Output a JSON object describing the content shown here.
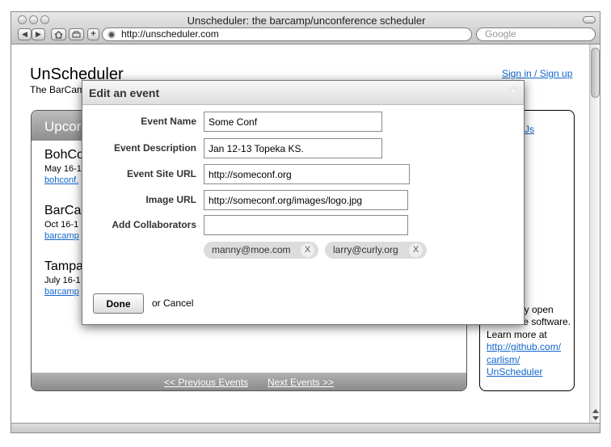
{
  "browser": {
    "window_title": "Unscheduler: the barcamp/unconference scheduler",
    "url": "http://unscheduler.com",
    "search_placeholder": "Google",
    "nav_back": "◀",
    "nav_forward": "▶",
    "add_bookmark": "+"
  },
  "site": {
    "title": "UnScheduler",
    "tagline": "The BarCam",
    "signin_label": "Sign in / Sign up"
  },
  "events_panel": {
    "title": "Upcor",
    "events": [
      {
        "name": "BohCo",
        "date": "May 16-1",
        "link": "bohconf."
      },
      {
        "name": "BarCa",
        "date": "Oct 16-1",
        "link": "barcamp"
      },
      {
        "name": "Tampa",
        "date": "July 16-1",
        "link": "barcamp"
      }
    ],
    "prev_label": "<< Previous Events",
    "next_label": "Next Events >>"
  },
  "aside": {
    "top_link": "Js",
    "text_lines": [
      "is",
      "by open",
      "source software.",
      "Learn more at"
    ],
    "link_lines": [
      "http://github.com/",
      "carlism/",
      "UnScheduler"
    ]
  },
  "dialog": {
    "title": "Edit an event",
    "close_glyph": "×",
    "fields": {
      "event_name": {
        "label": "Event Name",
        "value": "Some Conf"
      },
      "event_description": {
        "label": "Event Description",
        "value": "Jan 12-13 Topeka KS."
      },
      "event_site_url": {
        "label": "Event Site URL",
        "value": "http://someconf.org"
      },
      "image_url": {
        "label": "Image URL",
        "value": "http://someconf.org/images/logo.jpg"
      },
      "add_collaborators": {
        "label": "Add Collaborators",
        "value": ""
      }
    },
    "collaborators": [
      {
        "email": "manny@moe.com",
        "remove": "X"
      },
      {
        "email": "larry@curly.org",
        "remove": "X"
      }
    ],
    "done_label": "Done",
    "cancel_label": "or Cancel"
  }
}
